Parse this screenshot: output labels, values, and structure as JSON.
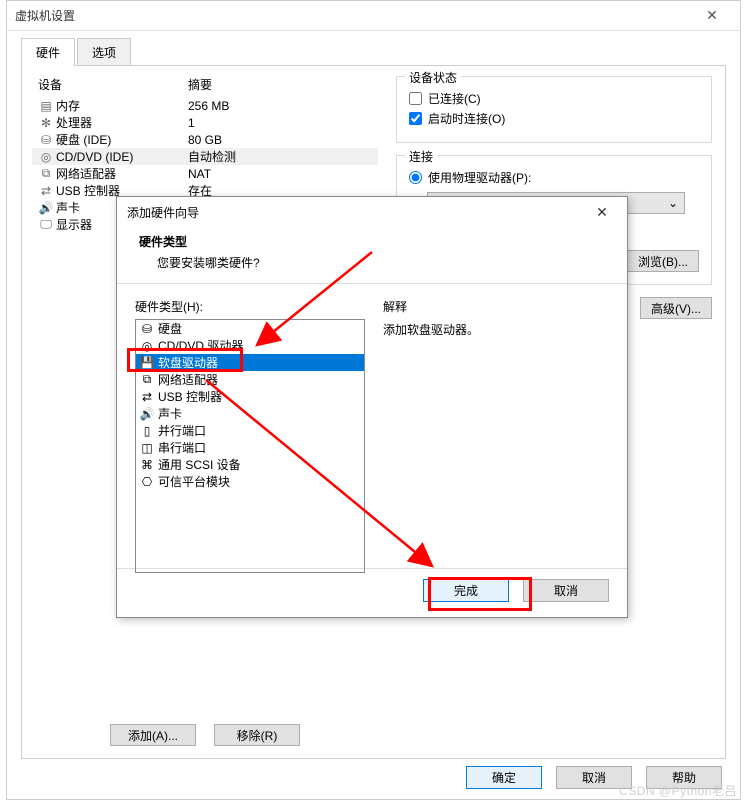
{
  "main": {
    "title": "虚拟机设置",
    "tabs": {
      "hardware": "硬件",
      "options": "选项"
    },
    "columns": {
      "device": "设备",
      "summary": "摘要"
    },
    "devices": [
      {
        "icon": "memory",
        "label": "内存",
        "summary": "256 MB"
      },
      {
        "icon": "cpu",
        "label": "处理器",
        "summary": "1"
      },
      {
        "icon": "disk",
        "label": "硬盘 (IDE)",
        "summary": "80 GB"
      },
      {
        "icon": "cd",
        "label": "CD/DVD (IDE)",
        "summary": "自动检测",
        "selected": true
      },
      {
        "icon": "net",
        "label": "网络适配器",
        "summary": "NAT"
      },
      {
        "icon": "usb",
        "label": "USB 控制器",
        "summary": "存在"
      },
      {
        "icon": "sound",
        "label": "声卡",
        "summary": ""
      },
      {
        "icon": "display",
        "label": "显示器",
        "summary": ""
      }
    ],
    "buttons": {
      "add": "添加(A)...",
      "remove": "移除(R)"
    },
    "right": {
      "groupStatus": "设备状态",
      "connected": "已连接(C)",
      "connectOnStart": "启动时连接(O)",
      "groupConn": "连接",
      "usePhysical": "使用物理驱动器(P):",
      "browse": "浏览(B)...",
      "advanced": "高级(V)..."
    },
    "footer": {
      "ok": "确定",
      "cancel": "取消",
      "help": "帮助"
    }
  },
  "wizard": {
    "title": "添加硬件向导",
    "heading": "硬件类型",
    "subhead": "您要安装哪类硬件?",
    "listLabel": "硬件类型(H):",
    "items": [
      {
        "icon": "disk",
        "label": "硬盘"
      },
      {
        "icon": "cd",
        "label": "CD/DVD 驱动器"
      },
      {
        "icon": "floppy",
        "label": "软盘驱动器",
        "selected": true
      },
      {
        "icon": "net",
        "label": "网络适配器"
      },
      {
        "icon": "usb",
        "label": "USB 控制器"
      },
      {
        "icon": "sound",
        "label": "声卡"
      },
      {
        "icon": "parallel",
        "label": "并行端口"
      },
      {
        "icon": "serial",
        "label": "串行端口"
      },
      {
        "icon": "scsi",
        "label": "通用 SCSI 设备"
      },
      {
        "icon": "tpm",
        "label": "可信平台模块"
      }
    ],
    "explainLabel": "解释",
    "explainText": "添加软盘驱动器。",
    "finish": "完成",
    "cancel": "取消"
  },
  "watermark": "CSDN @Python老吕"
}
